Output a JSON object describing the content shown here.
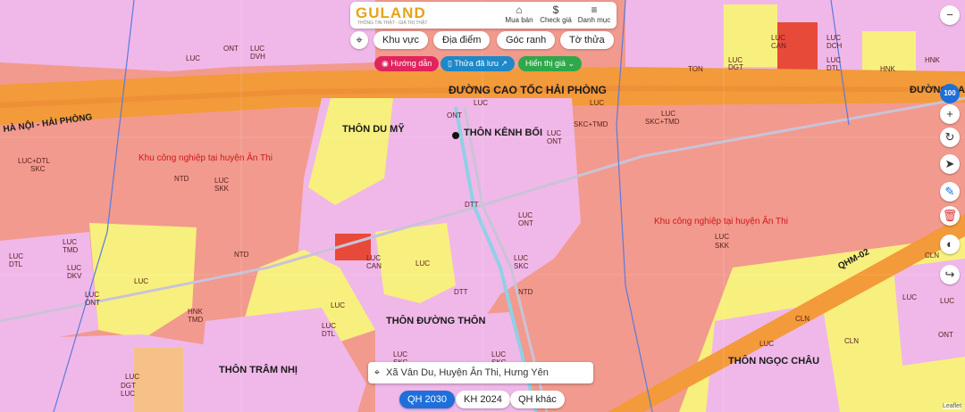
{
  "header": {
    "logo": "GULAND",
    "logo_sub": "THÔNG TIN THẬT - GIÁ TRỊ THẬT",
    "buttons": [
      {
        "label": "Mua bán",
        "icon": "store-icon"
      },
      {
        "label": "Check giá",
        "icon": "dollar-icon"
      },
      {
        "label": "Danh mục",
        "icon": "menu-icon"
      }
    ]
  },
  "tabs": [
    "Khu vực",
    "Địa điểm",
    "Góc ranh",
    "Tờ thửa"
  ],
  "pills": [
    {
      "label": "Hướng dẫn",
      "color": "#e0245e"
    },
    {
      "label": "Thửa đã lưu ↗",
      "color": "#1e88c8"
    },
    {
      "label": "Hiển thị giá ⌄",
      "color": "#2ea84a"
    }
  ],
  "zoom_level": "100",
  "address": "Xã Vân Du, Huyện Ân Thi, Hưng Yên",
  "bottom_tabs": [
    {
      "label": "QH 2030",
      "active": true
    },
    {
      "label": "KH 2024",
      "active": false
    },
    {
      "label": "QH khác",
      "active": false
    }
  ],
  "attribution": "Leaflet",
  "map_labels": {
    "highway_main": "ĐƯỜNG CAO TỐC HẢI PHÒNG",
    "highway_left": "HÀ NỘI - HẢI PHÒNG",
    "highway_right": "ĐƯỜNG CA",
    "qhm": "QHM-02",
    "industrial_1": "Khu công nghiệp tại huyện Ân Thi",
    "industrial_2": "Khu công nghiệp tại huyện Ân Thi",
    "villages": [
      "THÔN DU MỸ",
      "THÔN KÊNH BỐI",
      "THÔN ĐƯỜNG THÔN",
      "THÔN TRÂM NHỊ",
      "THÔN NGỌC CHÂU"
    ],
    "zones": [
      "ONT",
      "LUC",
      "LUC TMD",
      "LUC DCH",
      "LUC DTL",
      "HNK",
      "LUC ONT",
      "LUC DVH",
      "LUC SKC",
      "LUC+DTL",
      "NTD",
      "LUC SKK",
      "SKC+TMD",
      "LUC SKC+TMD",
      "LUC SKK",
      "CLN",
      "DTT",
      "LUC DKV",
      "HNK TMD",
      "LUC DTL",
      "LUC DGT",
      "LUC CAN",
      "ONT",
      "TON",
      "LUC SKC"
    ]
  },
  "colors": {
    "industrial": "#f29a8e",
    "residential": "#f0b8e8",
    "rice": "#f7f07e",
    "highway": "#f39a3a",
    "road": "#d8cfe0"
  }
}
